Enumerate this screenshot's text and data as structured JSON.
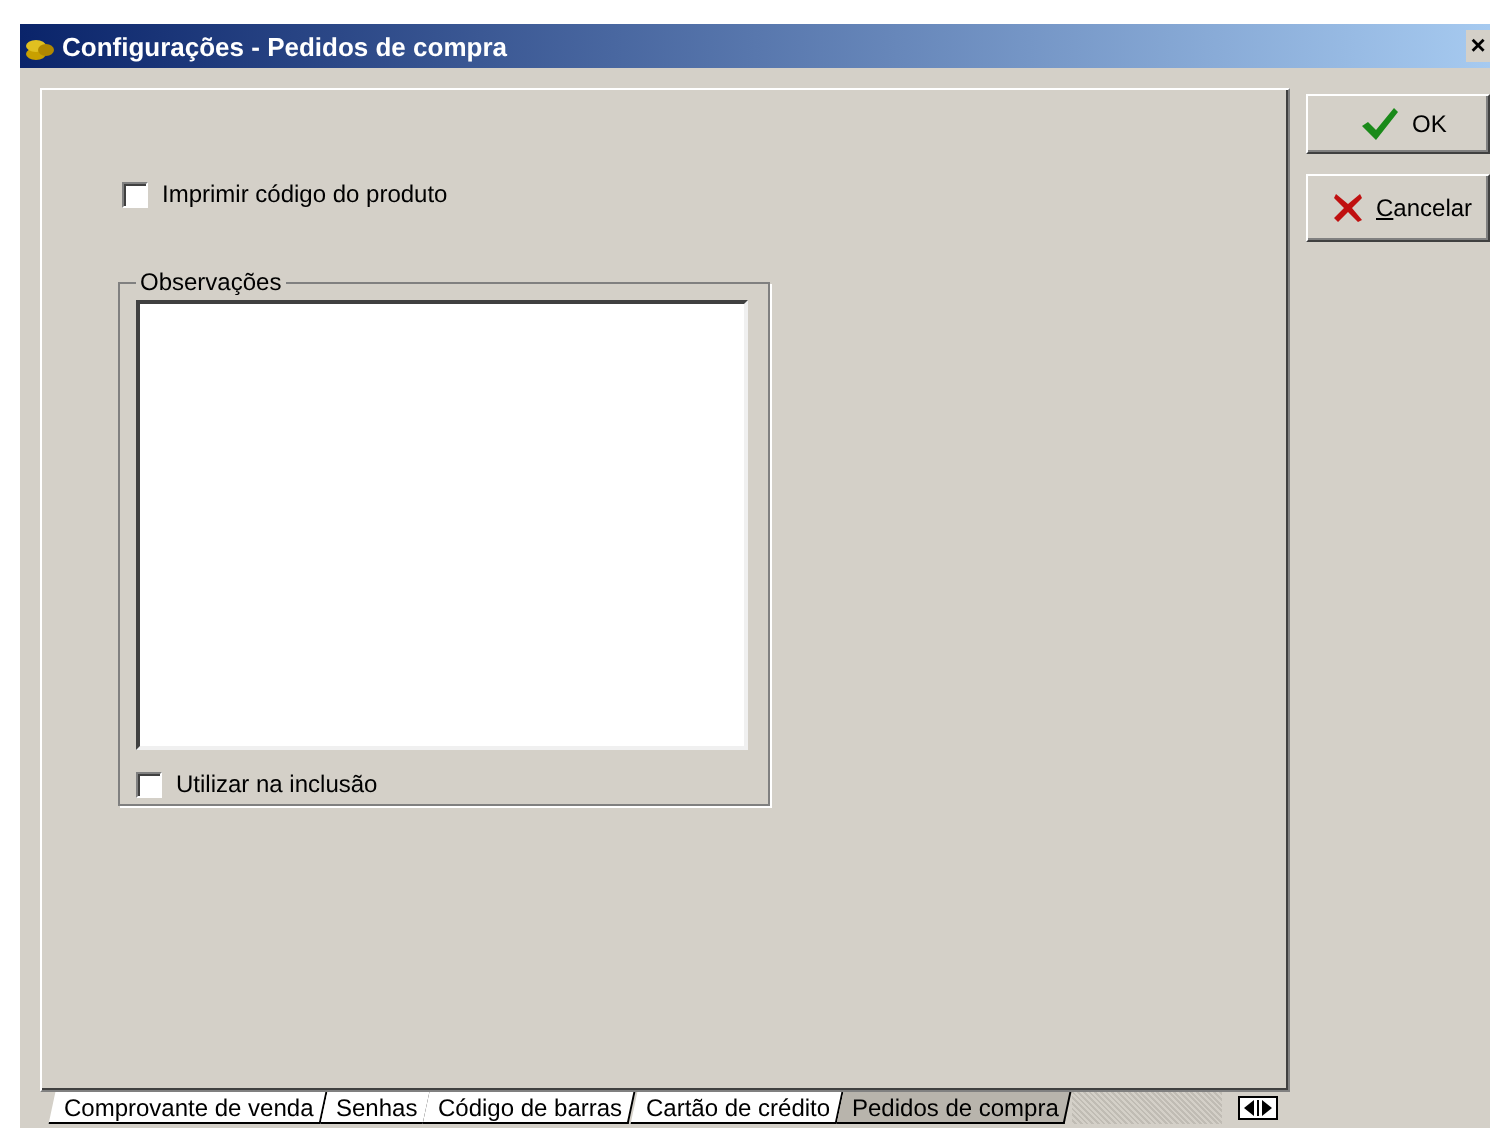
{
  "window": {
    "title": "Configurações - Pedidos de compra",
    "close": "×"
  },
  "options": [
    {
      "label": "Imprimir código do produto",
      "checked": false
    }
  ],
  "observations": {
    "legend": "Observações",
    "use_on_insert": {
      "label": "Utilizar na inclusão",
      "checked": false
    }
  },
  "buttons": [
    {
      "kind": "ok",
      "label": "OK"
    },
    {
      "kind": "cancel",
      "label": "Cancelar"
    }
  ],
  "tabs": [
    {
      "label": "Comprovante de venda",
      "selected": false
    },
    {
      "label": "Senhas",
      "selected": false
    },
    {
      "label": "Código de barras",
      "selected": false
    },
    {
      "label": "Cartão de crédito",
      "selected": false
    },
    {
      "label": "Pedidos de compra",
      "selected": true
    }
  ]
}
